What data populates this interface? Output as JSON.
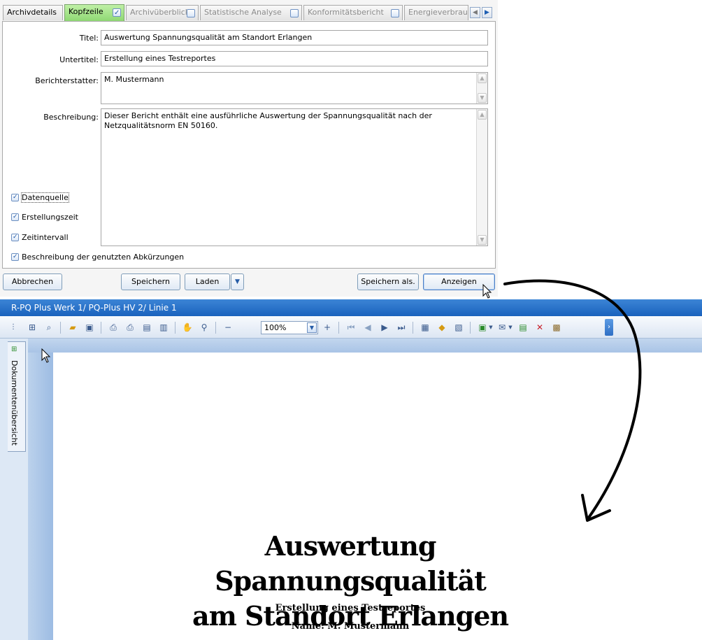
{
  "tabs": [
    {
      "label": "Archivdetails",
      "active": false,
      "enabled": true
    },
    {
      "label": "Kopfzeile",
      "active": true,
      "checked": true
    },
    {
      "label": "Archivüberblick",
      "active": false,
      "checked": false
    },
    {
      "label": "Statistische Analyse",
      "active": false,
      "checked": false
    },
    {
      "label": "Konformitätsbericht",
      "active": false,
      "checked": false
    },
    {
      "label": "Energieverbrau",
      "active": false,
      "checked": false
    }
  ],
  "form": {
    "title_label": "Titel:",
    "title_value": "Auswertung Spannungsqualität  am Standort Erlangen",
    "subtitle_label": "Untertitel:",
    "subtitle_value": "Erstellung eines Testreportes",
    "reporter_label": "Berichterstatter:",
    "reporter_value": "M. Mustermann",
    "description_label": "Beschreibung:",
    "description_value": "Dieser Bericht enthält eine ausführliche Auswertung der Spannungsqualität nach der Netzqualitätsnorm EN 50160."
  },
  "checkboxes": [
    {
      "label": "Datenquelle",
      "checked": true,
      "focused": true
    },
    {
      "label": "Erstellungszeit",
      "checked": true
    },
    {
      "label": "Zeitintervall",
      "checked": true
    },
    {
      "label": "Beschreibung der genutzten Abkürzungen",
      "checked": true
    }
  ],
  "buttons": {
    "cancel": "Abbrechen",
    "save": "Speichern",
    "load": "Laden",
    "save_as": "Speichern als.",
    "show": "Anzeigen"
  },
  "viewer": {
    "title": "R-PQ Plus Werk 1/ PQ-Plus HV 2/ Linie 1",
    "zoom": "100%",
    "side_tab": "Dokumentenübersicht"
  },
  "report": {
    "title_line1": "Auswertung Spannungsqualität",
    "title_line2": "am Standort Erlangen",
    "subtitle": "Erstellung eines Testreportes",
    "name": "Name: M. Mustermann"
  },
  "colors": {
    "active_tab": "#8fd873",
    "viewer_titlebar": "#2a72c8",
    "viewer_band": "#a9c4e6"
  }
}
